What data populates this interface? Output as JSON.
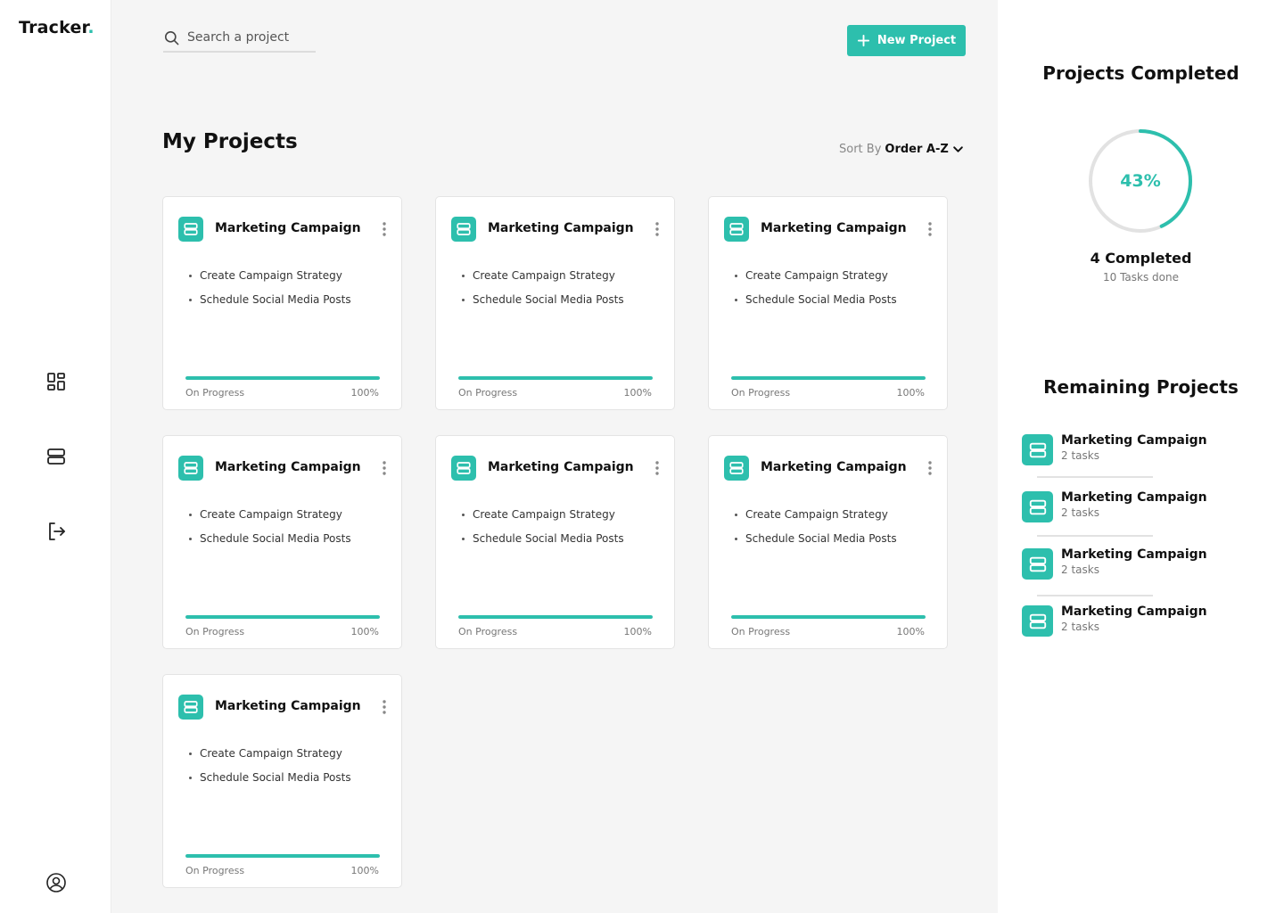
{
  "app": {
    "logo_text": "Tracker",
    "logo_dot": ".",
    "accent_color": "#2dbfad"
  },
  "sidebar": {
    "items": [
      {
        "icon": "dashboard-icon"
      },
      {
        "icon": "projects-icon"
      },
      {
        "icon": "logout-icon"
      },
      {
        "icon": "user-profile-icon"
      }
    ]
  },
  "header": {
    "search_placeholder": "Search a project",
    "new_project_label": "New Project"
  },
  "main": {
    "title": "My Projects",
    "sort_label": "Sort By",
    "sort_value": "Order A-Z"
  },
  "projects": [
    {
      "title": "Marketing Campaign",
      "tasks": [
        "Create Campaign Strategy",
        "Schedule Social Media Posts"
      ],
      "status": "On Progress",
      "progress_label": "100%",
      "progress": 1.0
    },
    {
      "title": "Marketing Campaign",
      "tasks": [
        "Create Campaign Strategy",
        "Schedule Social Media Posts"
      ],
      "status": "On Progress",
      "progress_label": "100%",
      "progress": 1.0
    },
    {
      "title": "Marketing Campaign",
      "tasks": [
        "Create Campaign Strategy",
        "Schedule Social Media Posts"
      ],
      "status": "On Progress",
      "progress_label": "100%",
      "progress": 1.0
    },
    {
      "title": "Marketing Campaign",
      "tasks": [
        "Create Campaign Strategy",
        "Schedule Social Media Posts"
      ],
      "status": "On Progress",
      "progress_label": "100%",
      "progress": 1.0
    },
    {
      "title": "Marketing Campaign",
      "tasks": [
        "Create Campaign Strategy",
        "Schedule Social Media Posts"
      ],
      "status": "On Progress",
      "progress_label": "100%",
      "progress": 1.0
    },
    {
      "title": "Marketing Campaign",
      "tasks": [
        "Create Campaign Strategy",
        "Schedule Social Media Posts"
      ],
      "status": "On Progress",
      "progress_label": "100%",
      "progress": 1.0
    },
    {
      "title": "Marketing Campaign",
      "tasks": [
        "Create Campaign Strategy",
        "Schedule Social Media Posts"
      ],
      "status": "On Progress",
      "progress_label": "100%",
      "progress": 1.0
    }
  ],
  "completed": {
    "title": "Projects Completed",
    "percent_label": "43%",
    "percent": 0.43,
    "count_label": "4 Completed",
    "tasks_done_label": "10 Tasks done"
  },
  "remaining": {
    "title": "Remaining Projects",
    "items": [
      {
        "title": "Marketing Campaign",
        "subtitle": "2 tasks"
      },
      {
        "title": "Marketing Campaign",
        "subtitle": "2 tasks"
      },
      {
        "title": "Marketing Campaign",
        "subtitle": "2 tasks"
      },
      {
        "title": "Marketing Campaign",
        "subtitle": "2 tasks"
      }
    ]
  }
}
